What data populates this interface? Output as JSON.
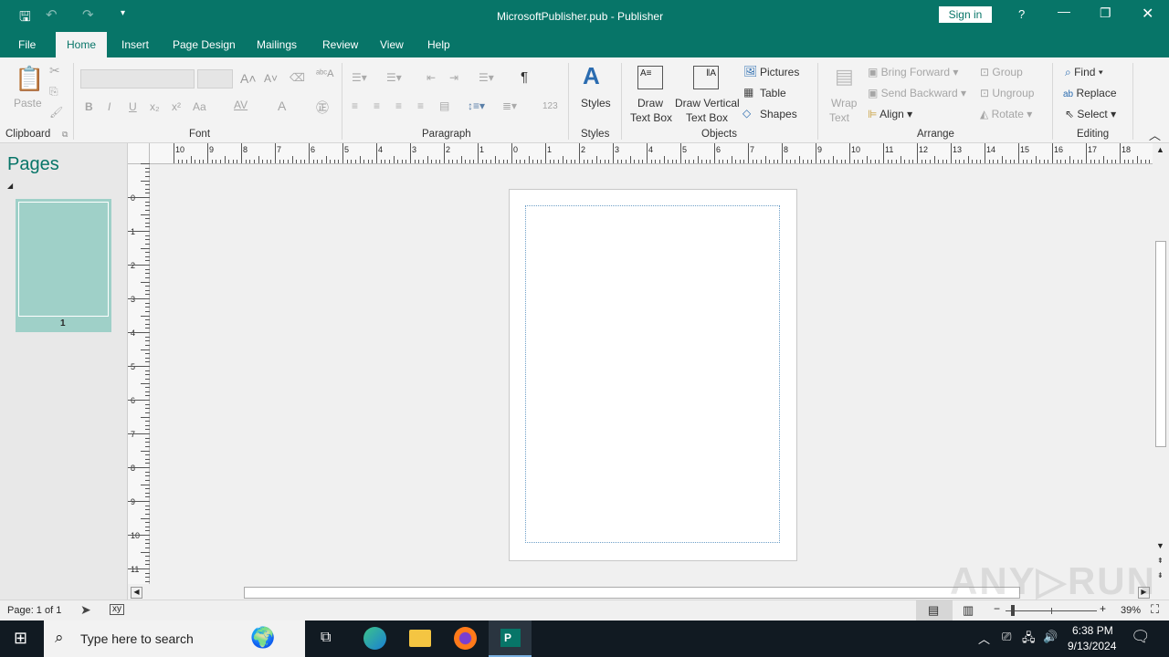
{
  "title": {
    "doc": "MicrosoftPublisher.pub  -  Publisher",
    "sign_in": "Sign in",
    "help": "?"
  },
  "tabs": [
    "File",
    "Home",
    "Insert",
    "Page Design",
    "Mailings",
    "Review",
    "View",
    "Help"
  ],
  "ribbon": {
    "clipboard": {
      "paste": "Paste",
      "label": "Clipboard"
    },
    "font": {
      "label": "Font",
      "bold": "B",
      "italic": "I",
      "underline": "U",
      "sub": "x₂",
      "sup": "x²",
      "case": "Aa",
      "spacing": "AV",
      "color": "A"
    },
    "paragraph": {
      "label": "Paragraph",
      "pilcrow": "¶",
      "numbers": "123"
    },
    "styles": {
      "styles": "Styles",
      "label": "Styles"
    },
    "objects": {
      "draw_text_box": [
        "Draw",
        "Text Box"
      ],
      "draw_vertical": [
        "Draw Vertical",
        "Text Box"
      ],
      "pictures": "Pictures",
      "table": "Table",
      "shapes": "Shapes",
      "label": "Objects"
    },
    "arrange": {
      "wrap": [
        "Wrap",
        "Text"
      ],
      "bring_forward": "Bring Forward",
      "send_backward": "Send Backward",
      "align": "Align",
      "group": "Group",
      "ungroup": "Ungroup",
      "rotate": "Rotate",
      "label": "Arrange"
    },
    "editing": {
      "find": "Find",
      "replace": "Replace",
      "select": "Select",
      "label": "Editing"
    }
  },
  "pages_pane": {
    "title": "Pages",
    "thumb_number": "1"
  },
  "ruler": {
    "h": [
      "10",
      "9",
      "8",
      "7",
      "6",
      "5",
      "4",
      "3",
      "2",
      "1",
      "0",
      "1",
      "2",
      "3",
      "4",
      "5",
      "6",
      "7",
      "8",
      "9",
      "10",
      "11",
      "12",
      "13",
      "14",
      "15",
      "16",
      "17",
      "18"
    ],
    "v": [
      "0",
      "1",
      "2",
      "3",
      "4",
      "5",
      "6",
      "7",
      "8",
      "9",
      "10",
      "11"
    ]
  },
  "status": {
    "page": "Page: 1 of 1",
    "zoom": "39%",
    "zoom_fraction": 0.39
  },
  "taskbar": {
    "search": "Type here to search",
    "time": "6:38 PM",
    "date": "9/13/2024"
  },
  "colors": {
    "accent": "#077568",
    "thumb": "#9fd0c8"
  }
}
